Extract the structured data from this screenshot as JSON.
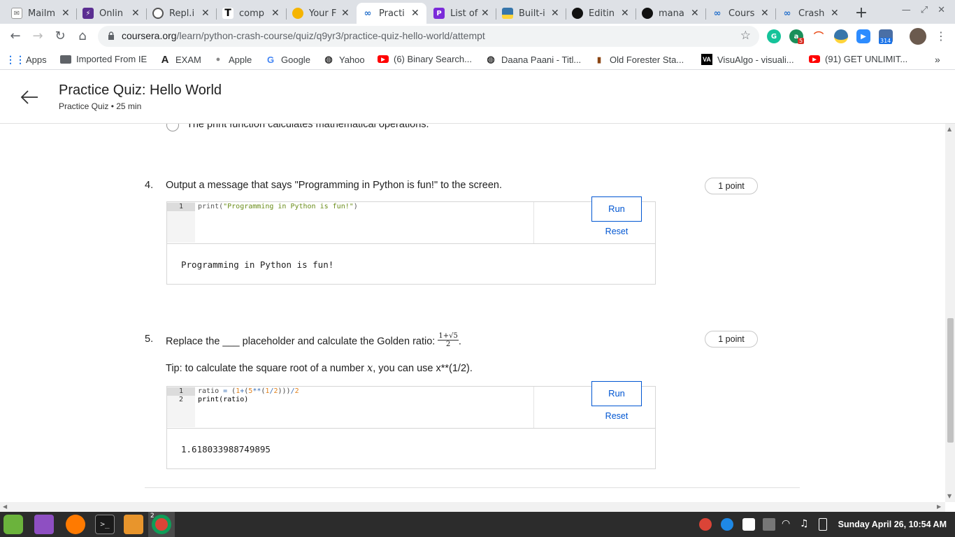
{
  "browser": {
    "tabs": [
      {
        "title": "Mailm",
        "icon": "mail-icon",
        "color": "#777777",
        "active": false
      },
      {
        "title": "Onlin",
        "icon": "bolt-icon",
        "color": "#5b2e91",
        "active": false
      },
      {
        "title": "Repl.i",
        "icon": "replit-icon",
        "color": "#555555",
        "active": false
      },
      {
        "title": "comp",
        "icon": "t-letter-icon",
        "color": "#000000",
        "active": false
      },
      {
        "title": "Your F",
        "icon": "colorful-circle-icon",
        "color": "#f5b400",
        "active": false
      },
      {
        "title": "Practi",
        "icon": "coursera-icon",
        "color": "#2a73cc",
        "active": true
      },
      {
        "title": "List of",
        "icon": "brand-p-icon",
        "color": "#7b2bd9",
        "active": false
      },
      {
        "title": "Built-i",
        "icon": "python-icon",
        "color": "#3776ab",
        "active": false
      },
      {
        "title": "Editin",
        "icon": "github-icon",
        "color": "#111111",
        "active": false
      },
      {
        "title": "mana",
        "icon": "github-icon",
        "color": "#111111",
        "active": false
      },
      {
        "title": "Cours",
        "icon": "coursera-icon",
        "color": "#2a73cc",
        "active": false
      },
      {
        "title": "Crash",
        "icon": "coursera-icon",
        "color": "#2a73cc",
        "active": false
      }
    ],
    "url_host": "coursera.org",
    "url_path": "/learn/python-crash-course/quiz/q9yr3/practice-quiz-hello-world/attempt",
    "extension_badges": {
      "grammarly_count": "5",
      "zoom_count": "314"
    },
    "bookmarks": [
      {
        "label": "Apps",
        "icon": "apps-grid-icon"
      },
      {
        "label": "Imported From IE",
        "icon": "folder-icon"
      },
      {
        "label": "EXAM",
        "icon": "a-logo-icon"
      },
      {
        "label": "Apple",
        "icon": "apple-icon"
      },
      {
        "label": "Google",
        "icon": "google-icon"
      },
      {
        "label": "Yahoo",
        "icon": "globe-icon"
      },
      {
        "label": "(6) Binary Search...",
        "icon": "youtube-icon"
      },
      {
        "label": "Daana Paani - Titl...",
        "icon": "globe-icon"
      },
      {
        "label": "Old Forester Sta...",
        "icon": "bottle-icon"
      },
      {
        "label": "VisuAlgo - visuali...",
        "icon": "visualgo-icon"
      },
      {
        "label": "(91) GET UNLIMIT...",
        "icon": "youtube-icon"
      }
    ]
  },
  "quiz": {
    "title": "Practice Quiz: Hello World",
    "subtitle": "Practice Quiz • 25 min",
    "prev_option_text": "The print function calculates mathematical operations.",
    "questions": [
      {
        "number": "4.",
        "text": "Output a message that says \"Programming in Python is fun!\" to the screen.",
        "points": "1 point",
        "code_lines": [
          "print(\"Programming in Python is fun!\")"
        ],
        "output": "Programming in Python is fun!",
        "run_label": "Run",
        "reset_label": "Reset"
      },
      {
        "number": "5.",
        "text": "Replace the ___ placeholder and calculate the Golden ratio:",
        "formula_numerator": "1+√5",
        "formula_denominator": "2",
        "tip_prefix": "Tip: to calculate the square root of a number",
        "tip_var": "x",
        "tip_suffix": ", you can use x**(1/2).",
        "points": "1 point",
        "code_lines": [
          "ratio = (1+(5**(1/2)))/2",
          "print(ratio)"
        ],
        "output": "1.618033988749895",
        "run_label": "Run",
        "reset_label": "Reset"
      }
    ]
  },
  "taskbar": {
    "clock": "Sunday April 26, 10:54 AM",
    "chrome_window_count": "2"
  }
}
